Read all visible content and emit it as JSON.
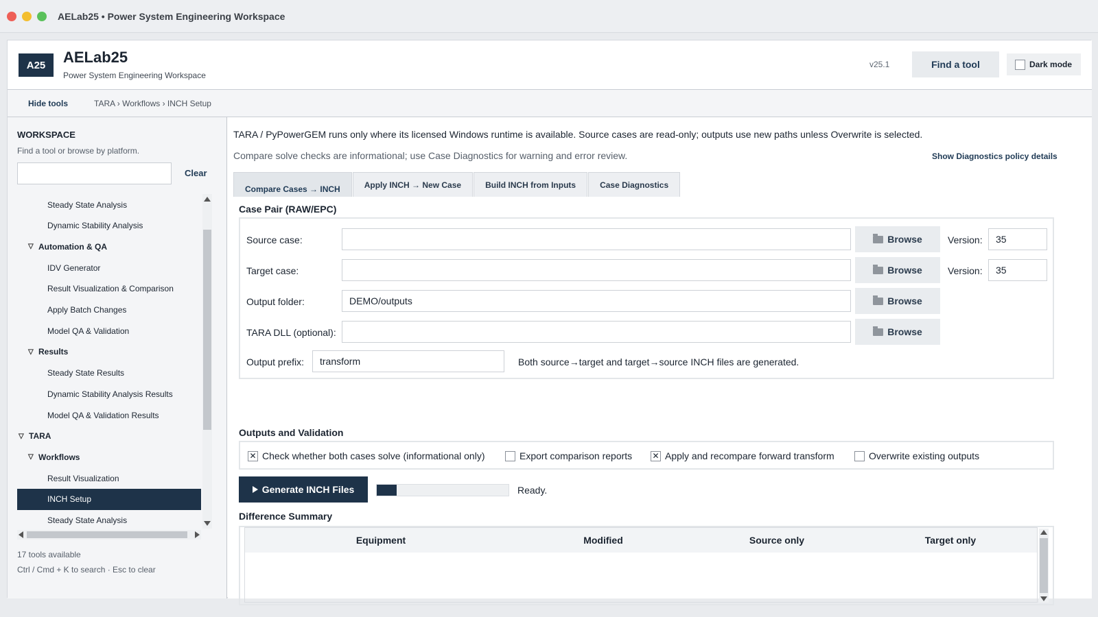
{
  "window": {
    "title": "AELab25 • Power System Engineering Workspace"
  },
  "header": {
    "logo": "A25",
    "app_name": "AELab25",
    "subtitle": "Power System Engineering Workspace",
    "version": "v25.1",
    "find_tool": "Find a tool",
    "dark_mode": "Dark mode"
  },
  "toolbar": {
    "hide_tools": "Hide tools",
    "breadcrumb": "TARA › Workflows › INCH Setup"
  },
  "sidebar": {
    "heading": "WORKSPACE",
    "subtitle": "Find a tool or browse by platform.",
    "search_value": "",
    "clear": "Clear",
    "items": [
      {
        "label": "Steady State Analysis",
        "level": 2
      },
      {
        "label": "Dynamic Stability Analysis",
        "level": 2
      },
      {
        "label": "Automation & QA",
        "level": 1,
        "group": true
      },
      {
        "label": "IDV Generator",
        "level": 2
      },
      {
        "label": "Result Visualization & Comparison",
        "level": 2
      },
      {
        "label": "Apply Batch Changes",
        "level": 2
      },
      {
        "label": "Model QA & Validation",
        "level": 2
      },
      {
        "label": "Results",
        "level": 1,
        "group": true
      },
      {
        "label": "Steady State Results",
        "level": 2
      },
      {
        "label": "Dynamic Stability Analysis Results",
        "level": 2
      },
      {
        "label": "Model QA & Validation Results",
        "level": 2
      },
      {
        "label": "TARA",
        "level": 0,
        "group": true
      },
      {
        "label": "Workflows",
        "level": 1,
        "group": true
      },
      {
        "label": "Result Visualization",
        "level": 2
      },
      {
        "label": "INCH Setup",
        "level": 2,
        "selected": true
      },
      {
        "label": "Steady State Analysis",
        "level": 2
      }
    ],
    "count": "17 tools available",
    "hint": "Ctrl / Cmd + K to search · Esc to clear"
  },
  "main": {
    "notice": "TARA / PyPowerGEM runs only where its licensed Windows runtime is available. Source cases are read-only; outputs use new paths unless Overwrite is selected.",
    "notice2": "Compare solve checks are informational; use Case Diagnostics for warning and error review.",
    "policy_link": "Show Diagnostics policy details",
    "tabs": [
      "Compare Cases → INCH",
      "Apply INCH → New Case",
      "Build INCH from Inputs",
      "Case Diagnostics"
    ],
    "case_pair_title": "Case Pair (RAW/EPC)",
    "source_label": "Source case:",
    "source_value": "",
    "target_label": "Target case:",
    "target_value": "",
    "output_label": "Output folder:",
    "output_value": "DEMO/outputs",
    "dll_label": "TARA DLL (optional):",
    "dll_value": "",
    "browse": "Browse",
    "version_label": "Version:",
    "source_version": "35",
    "target_version": "35",
    "prefix_label": "Output prefix:",
    "prefix_value": "transform",
    "prefix_note": "Both source→target and target→source INCH files are generated.",
    "outputs_title": "Outputs and Validation",
    "options": [
      {
        "label": "Check whether both cases solve (informational only)",
        "checked": true
      },
      {
        "label": "Export comparison reports",
        "checked": false
      },
      {
        "label": "Apply and recompare forward transform",
        "checked": true
      },
      {
        "label": "Overwrite existing outputs",
        "checked": false
      }
    ],
    "generate": "Generate INCH Files",
    "progress": 0.15,
    "status": "Ready.",
    "diff_title": "Difference Summary",
    "columns": [
      "Equipment",
      "Modified",
      "Source only",
      "Target only"
    ]
  },
  "colors": {
    "accent": "#1e3349",
    "link": "#1f3a55"
  }
}
